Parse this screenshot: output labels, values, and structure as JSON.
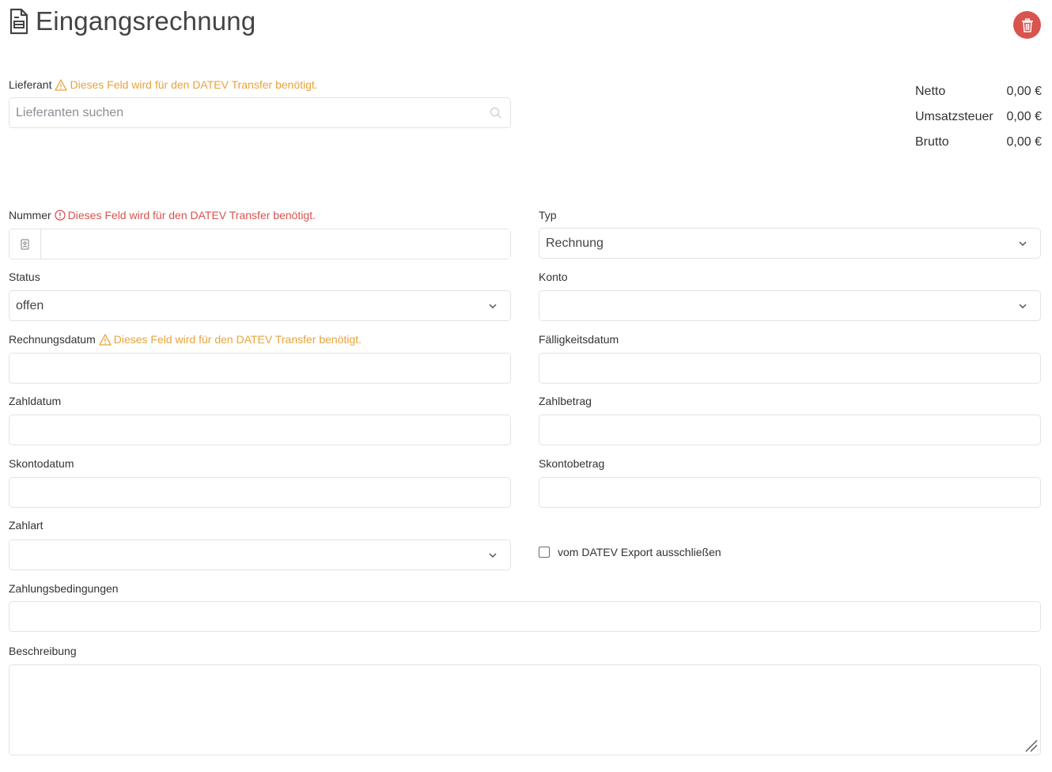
{
  "header": {
    "title": "Eingangsrechnung",
    "icon": "document-icon",
    "delete_icon": "trash-icon",
    "delete_color": "#d9534f"
  },
  "warning_color": "#e8a33b",
  "error_color": "#d9534f",
  "supplier": {
    "label": "Lieferant",
    "warning": "Dieses Feld wird für den DATEV Transfer benötigt.",
    "placeholder": "Lieferanten suchen"
  },
  "totals": [
    {
      "label": "Netto",
      "value": "0,00 €"
    },
    {
      "label": "Umsatzsteuer",
      "value": "0,00 €"
    },
    {
      "label": "Brutto",
      "value": "0,00 €"
    }
  ],
  "number": {
    "label": "Nummer",
    "error": "Dieses Feld wird für den DATEV Transfer benötigt.",
    "value": ""
  },
  "type": {
    "label": "Typ",
    "value": "Rechnung"
  },
  "status": {
    "label": "Status",
    "value": "offen"
  },
  "account": {
    "label": "Konto",
    "value": ""
  },
  "invoice_date": {
    "label": "Rechnungsdatum",
    "warning": "Dieses Feld wird für den DATEV Transfer benötigt.",
    "value": ""
  },
  "due_date": {
    "label": "Fälligkeitsdatum",
    "value": ""
  },
  "payment_date": {
    "label": "Zahldatum",
    "value": ""
  },
  "payment_amount": {
    "label": "Zahlbetrag",
    "value": ""
  },
  "discount_date": {
    "label": "Skontodatum",
    "value": ""
  },
  "discount_amount": {
    "label": "Skontobetrag",
    "value": ""
  },
  "payment_method": {
    "label": "Zahlart",
    "value": ""
  },
  "exclude_datev": {
    "label": "vom DATEV Export ausschließen",
    "checked": false
  },
  "payment_terms": {
    "label": "Zahlungsbedingungen",
    "value": ""
  },
  "description": {
    "label": "Beschreibung",
    "value": ""
  }
}
